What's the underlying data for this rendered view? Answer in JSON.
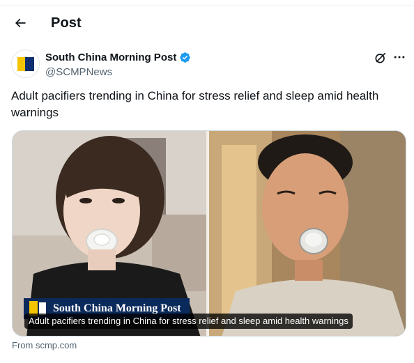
{
  "header": {
    "back_icon": "arrow-left-icon",
    "title": "Post"
  },
  "author": {
    "name": "South China Morning Post",
    "handle": "@SCMPNews",
    "verified": true,
    "verified_color": "#1d9bf0",
    "grok_icon": "grok-icon",
    "more_icon": "more-horizontal-icon"
  },
  "post": {
    "text": "Adult pacifiers trending in China for stress relief and sleep amid health warnings"
  },
  "media": {
    "brand_overlay": "South China Morning Post",
    "caption": "Adult pacifiers trending in China for stress relief and sleep amid health warnings"
  },
  "link_source": "From scmp.com",
  "colors": {
    "text_primary": "#0f1419",
    "text_secondary": "#536471",
    "brand_navy": "#0b2a5c",
    "brand_yellow": "#f5c400"
  }
}
